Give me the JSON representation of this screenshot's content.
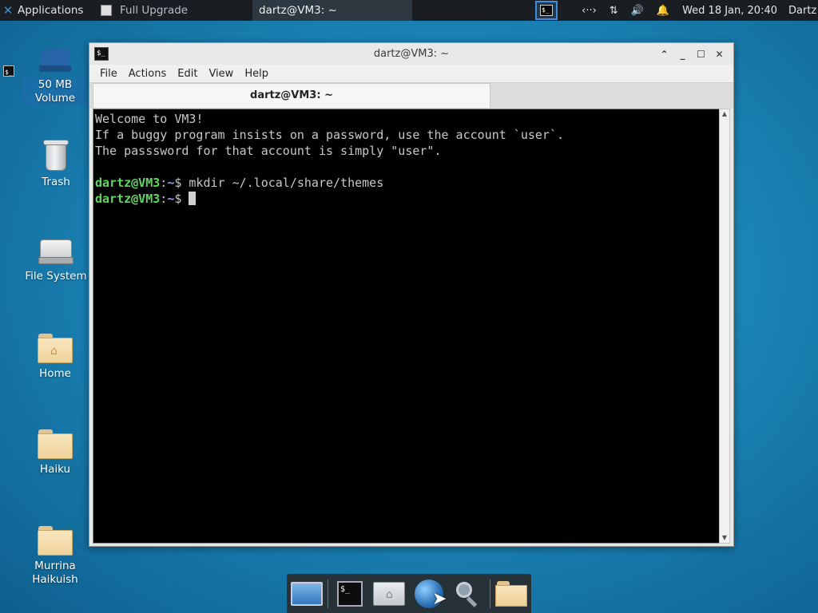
{
  "panel": {
    "applications_label": "Applications",
    "tasks": [
      {
        "label": "Full Upgrade"
      },
      {
        "label": "dartz@VM3: ~"
      }
    ],
    "tray": {
      "network_glyph": "‹··›",
      "transfer_glyph": "⇅",
      "volume_glyph": "🔊",
      "notify_glyph": "🔔",
      "clock": "Wed 18 Jan, 20:40",
      "user": "Dartz"
    }
  },
  "desktop": {
    "icons": [
      {
        "label": "50 MB Volume"
      },
      {
        "label": "Trash"
      },
      {
        "label": "File System"
      },
      {
        "label": "Home"
      },
      {
        "label": "Haiku"
      },
      {
        "label": "Murrina Haikuish"
      }
    ]
  },
  "window": {
    "title": "dartz@VM3: ~",
    "menu": [
      "File",
      "Actions",
      "Edit",
      "View",
      "Help"
    ],
    "tab_label": "dartz@VM3: ~",
    "terminal": {
      "lines": [
        "Welcome to VM3!",
        "If a buggy program insists on a password, use the account `user`.",
        "The passsword for that account is simply \"user\"."
      ],
      "prompt_user_host": "dartz@VM3",
      "prompt_colon": ":",
      "prompt_path": "~",
      "prompt_symbol": "$ ",
      "command": "mkdir ~/.local/share/themes"
    }
  },
  "colors": {
    "desktop_bg": "#1b86b8",
    "panel_bg": "#1a1d21",
    "prompt_user": "#5fd75f",
    "prompt_path": "#8fa0ff"
  },
  "dock_items": [
    "show-desktop-icon",
    "terminal-icon",
    "home-folder-icon",
    "web-browser-icon",
    "search-icon",
    "folder-icon"
  ]
}
